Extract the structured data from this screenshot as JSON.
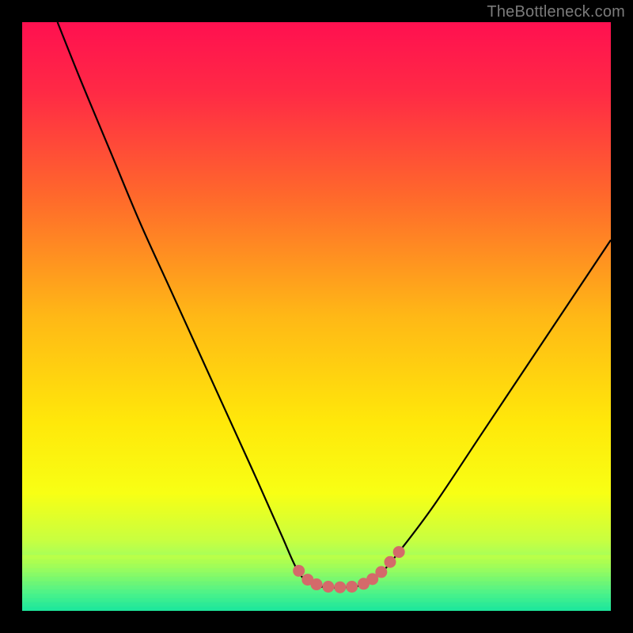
{
  "watermark": "TheBottleneck.com",
  "colors": {
    "frame": "#000000",
    "gradient_stops": [
      {
        "offset": 0.0,
        "color": "#ff1050"
      },
      {
        "offset": 0.12,
        "color": "#ff2a45"
      },
      {
        "offset": 0.3,
        "color": "#ff6a2b"
      },
      {
        "offset": 0.5,
        "color": "#ffb816"
      },
      {
        "offset": 0.68,
        "color": "#ffe80a"
      },
      {
        "offset": 0.8,
        "color": "#f8ff14"
      },
      {
        "offset": 0.88,
        "color": "#c8ff40"
      },
      {
        "offset": 0.93,
        "color": "#8cff6e"
      },
      {
        "offset": 0.97,
        "color": "#40f59a"
      },
      {
        "offset": 1.0,
        "color": "#17e6a0"
      }
    ],
    "curve": "#000000",
    "marker_fill": "#d46a6a",
    "marker_stroke": "#b85454"
  },
  "chart_data": {
    "type": "line",
    "title": "",
    "xlabel": "",
    "ylabel": "",
    "xlim": [
      0,
      100
    ],
    "ylim": [
      0,
      100
    ],
    "series": [
      {
        "name": "bottleneck-curve",
        "x": [
          6,
          10,
          15,
          20,
          25,
          30,
          35,
          40,
          44,
          47,
          49.5,
          52,
          55,
          58,
          61,
          64,
          70,
          78,
          86,
          94,
          100
        ],
        "y": [
          100,
          90,
          78,
          66,
          55,
          44,
          33,
          22,
          13,
          6.5,
          4.5,
          4.0,
          4.0,
          4.5,
          6.5,
          10,
          18,
          30,
          42,
          54,
          63
        ]
      }
    ],
    "markers": {
      "name": "highlight-band",
      "points": [
        {
          "x": 47.0,
          "y": 6.8
        },
        {
          "x": 48.5,
          "y": 5.3
        },
        {
          "x": 50.0,
          "y": 4.5
        },
        {
          "x": 52.0,
          "y": 4.1
        },
        {
          "x": 54.0,
          "y": 4.0
        },
        {
          "x": 56.0,
          "y": 4.1
        },
        {
          "x": 58.0,
          "y": 4.6
        },
        {
          "x": 59.5,
          "y": 5.4
        },
        {
          "x": 61.0,
          "y": 6.6
        },
        {
          "x": 62.5,
          "y": 8.3
        },
        {
          "x": 64.0,
          "y": 10.0
        }
      ]
    },
    "grid": false,
    "legend": false
  }
}
